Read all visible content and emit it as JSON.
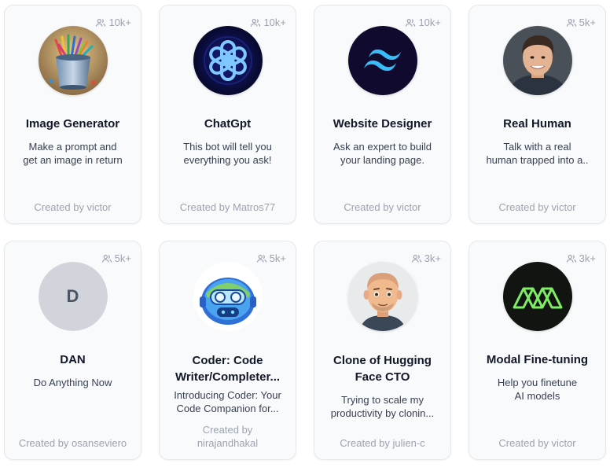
{
  "cards": [
    {
      "users": "10k+",
      "avatar": "paint-bucket-icon",
      "title": "Image Generator",
      "desc_lines": [
        "Make a prompt and",
        "get an image in return"
      ],
      "creator": "Created by victor"
    },
    {
      "users": "10k+",
      "avatar": "openai-logo-icon",
      "title": "ChatGpt",
      "desc_lines": [
        "This bot will tell you",
        "everything you ask!"
      ],
      "creator": "Created by Matros77"
    },
    {
      "users": "10k+",
      "avatar": "tailwind-logo-icon",
      "title": "Website Designer",
      "desc_lines": [
        "Ask an expert to build",
        "your landing page."
      ],
      "creator": "Created by victor"
    },
    {
      "users": "5k+",
      "avatar": "human-portrait-icon",
      "title": "Real Human",
      "desc_lines": [
        "Talk with a real",
        "human trapped into a.."
      ],
      "creator": "Created by victor"
    },
    {
      "users": "5k+",
      "avatar_letter": "D",
      "title": "DAN",
      "desc_lines": [
        "Do Anything Now"
      ],
      "creator": "Created by osanseviero"
    },
    {
      "users": "5k+",
      "avatar": "robot-mascot-icon",
      "title_lines": [
        "Coder: Code",
        "Writer/Completer..."
      ],
      "desc_lines": [
        "Introducing Coder: Your",
        "Code Companion for..."
      ],
      "creator_lines": [
        "Created by",
        "nirajandhakal"
      ]
    },
    {
      "users": "3k+",
      "avatar": "memoji-face-icon",
      "title_lines": [
        "Clone of Hugging",
        "Face CTO"
      ],
      "desc_lines": [
        "Trying to scale my",
        "productivity by clonin..."
      ],
      "creator": "Created by julien-c"
    },
    {
      "users": "3k+",
      "avatar": "modal-logo-icon",
      "title": "Modal Fine-tuning",
      "desc_lines": [
        "Help you finetune",
        "AI models"
      ],
      "creator": "Created by victor"
    }
  ]
}
